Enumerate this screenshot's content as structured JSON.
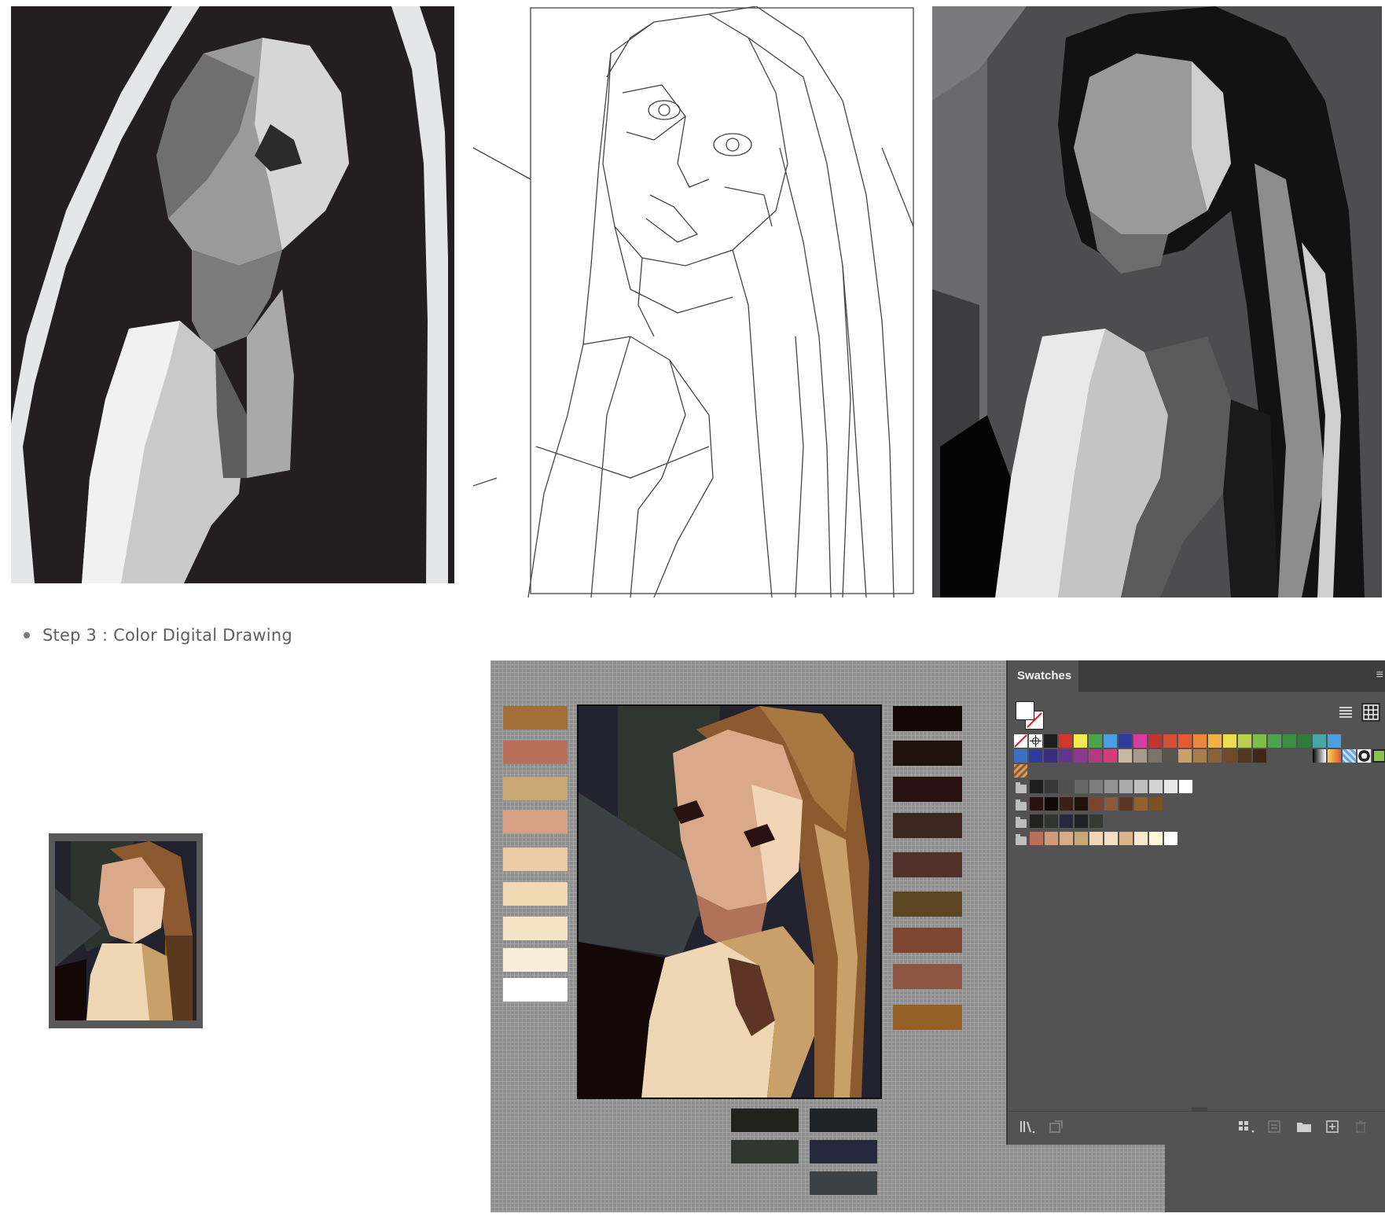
{
  "step_label": "Step 3 : Color Digital Drawing",
  "swatches_panel": {
    "tab_label": "Swatches",
    "menu_icon": "hamburger-menu-icon",
    "list_view_icon": "list-view-icon",
    "grid_view_icon": "grid-view-icon",
    "row1_colors": [
      "#1e1e1e",
      "#d1352e",
      "#f5e94f",
      "#4aa44d",
      "#4b9fe0",
      "#2d3b9c",
      "#d43ea0",
      "#c2352e",
      "#d05038",
      "#e25b35",
      "#e9873a",
      "#f3b244",
      "#eedd4f",
      "#b9d04a",
      "#7dbf48",
      "#4aa44d",
      "#3a8e3f",
      "#2d7c3a",
      "#4aa6a4",
      "#4b9fe0"
    ],
    "row2_colors": [
      "#3f6fc5",
      "#2d3b9c",
      "#3a2a80",
      "#62358e",
      "#8b3a8d",
      "#b23a7e",
      "#d43e78",
      "#c9b8a0",
      "#a79a8a",
      "#7d736a",
      "#5a534d",
      "#c9a06a",
      "#a77f4e",
      "#8a6239",
      "#6e4a2b",
      "#553620",
      "#3f2718"
    ],
    "gray_group": [
      "#1e1e1e",
      "#383838",
      "#4f4f4f",
      "#666666",
      "#7d7d7d",
      "#939393",
      "#aaaaaa",
      "#bfbfbf",
      "#d4d4d4",
      "#e8e8e8",
      "#ffffff"
    ],
    "brown_group": [
      "#2b1212",
      "#140707",
      "#3a1f17",
      "#201208",
      "#7b4430",
      "#8a5a3d",
      "#5e3524",
      "#966029",
      "#7a5222"
    ],
    "dark_group": [
      "#20221b",
      "#2f3630",
      "#26293e",
      "#1f2326",
      "#353a33"
    ],
    "skin_group": [
      "#b87058",
      "#d09a7b",
      "#d8ab88",
      "#c8a775",
      "#efd7b5",
      "#f3e0c3",
      "#d9b68a",
      "#f6e8cc",
      "#fff4dc",
      "#ffffff"
    ],
    "bottom_icons": [
      "swatch-libraries-icon",
      "place-swatches-icon",
      "show-kinds-icon",
      "swatch-options-icon",
      "new-color-group-icon",
      "new-swatch-icon",
      "delete-swatch-icon"
    ]
  },
  "canvas_palette_left": [
    "#a26f39",
    "#b8705b",
    "#c9a774",
    "#d7a183",
    "#eccaa3",
    "#f1d9b4",
    "#f5e4c6",
    "#f9ecd8",
    "#ffffff"
  ],
  "canvas_palette_right": [
    "#140707",
    "#20120c",
    "#2b1212",
    "#3c271f",
    "#50322a",
    "#5d4623",
    "#7c4630",
    "#8c5642",
    "#966029"
  ],
  "canvas_palette_bottom": [
    "#20221b",
    "#1f2326",
    "#2f3630",
    "#26293e",
    "#3b4246"
  ]
}
